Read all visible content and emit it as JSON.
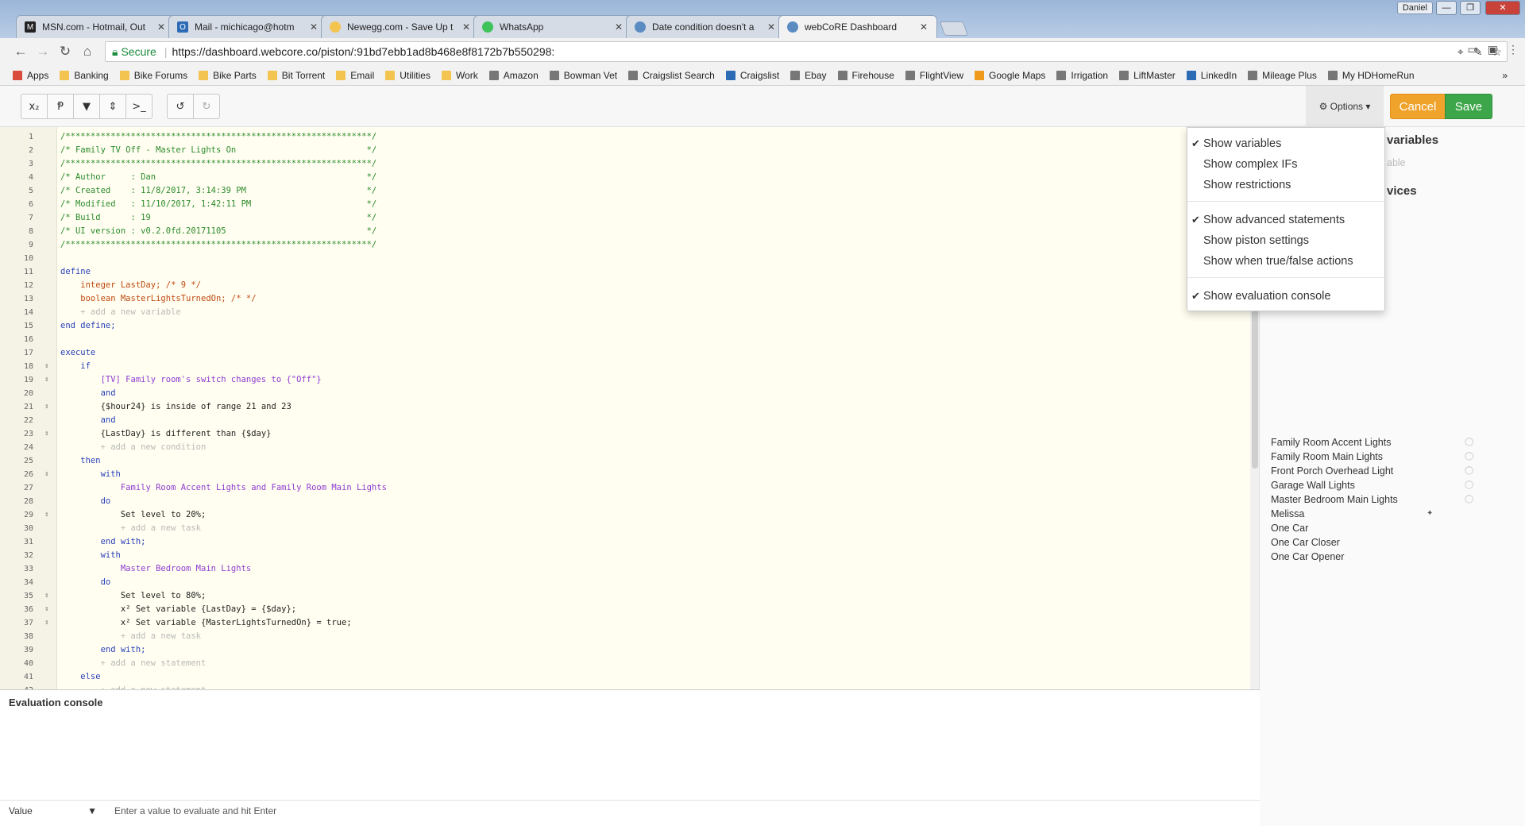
{
  "browser": {
    "tabs": [
      {
        "title": "MSN.com - Hotmail, Out",
        "icon_color": "#222"
      },
      {
        "title": "Mail - michicago@hotm",
        "icon_color": "#2d6bb5"
      },
      {
        "title": "Newegg.com - Save Up t",
        "icon_color": "#f3c44f"
      },
      {
        "title": "WhatsApp",
        "icon_color": "#3ec35b"
      },
      {
        "title": "Date condition doesn't a",
        "icon_color": "#5a8cc2"
      },
      {
        "title": "webCoRE Dashboard",
        "icon_color": "#5a8cc2"
      }
    ],
    "user": "Daniel",
    "window_title": "",
    "secure_label": "Secure",
    "url_host": "https://dashboard.webcore.co",
    "url_path": "/piston/:91bd7ebb1ad8b468e8f8172b7b550298:",
    "bookmarks": [
      {
        "label": "Apps",
        "icon": "apps-grid-icon"
      },
      {
        "label": "Banking",
        "icon": "folder-icon"
      },
      {
        "label": "Bike Forums",
        "icon": "folder-icon"
      },
      {
        "label": "Bike Parts",
        "icon": "folder-icon"
      },
      {
        "label": "Bit Torrent",
        "icon": "folder-icon"
      },
      {
        "label": "Email",
        "icon": "folder-icon"
      },
      {
        "label": "Utilities",
        "icon": "folder-icon"
      },
      {
        "label": "Work",
        "icon": "folder-icon"
      },
      {
        "label": "Amazon",
        "icon": "amazon-icon"
      },
      {
        "label": "Bowman Vet",
        "icon": "page-icon"
      },
      {
        "label": "Craigslist Search",
        "icon": "page-icon"
      },
      {
        "label": "Craigslist",
        "icon": "peace-icon"
      },
      {
        "label": "Ebay",
        "icon": "page-icon"
      },
      {
        "label": "Firehouse",
        "icon": "page-icon"
      },
      {
        "label": "FlightView",
        "icon": "page-icon"
      },
      {
        "label": "Google Maps",
        "icon": "map-icon"
      },
      {
        "label": "Irrigation",
        "icon": "page-icon"
      },
      {
        "label": "LiftMaster",
        "icon": "page-icon"
      },
      {
        "label": "LinkedIn",
        "icon": "linkedin-icon"
      },
      {
        "label": "Mileage Plus",
        "icon": "page-icon"
      },
      {
        "label": "My HDHomeRun",
        "icon": "page-icon"
      }
    ],
    "bookmarks_more": "»"
  },
  "toolbar": {
    "buttons": [
      "x₂",
      "Ᵽ",
      "▼",
      "⇕",
      ">_"
    ],
    "undo": "↺",
    "redo": "↻",
    "options_label": "⚙ Options ▾",
    "cancel_label": "Cancel",
    "save_label": "Save"
  },
  "options_menu": {
    "items": [
      {
        "label": "Show variables",
        "checked": true
      },
      {
        "label": "Show complex IFs",
        "checked": false
      },
      {
        "label": "Show restrictions",
        "checked": false
      },
      {
        "label": "Show advanced statements",
        "checked": true
      },
      {
        "label": "Show piston settings",
        "checked": false
      },
      {
        "label": "Show when true/false actions",
        "checked": false
      },
      {
        "label": "Show evaluation console",
        "checked": true
      }
    ]
  },
  "sidebar": {
    "variables_heading": "variables",
    "variables_hint": "able",
    "devices_heading": "vices",
    "devices": [
      "Family Room Accent Lights",
      "Family Room Main Lights",
      "Front Porch Overhead Light",
      "Garage Wall Lights",
      "Master Bedroom Main Lights",
      "Melissa",
      "One Car",
      "One Car Closer",
      "One Car Opener"
    ]
  },
  "code": {
    "lines": [
      "/*************************************************************/",
      "/* Family TV Off - Master Lights On                          */",
      "/*************************************************************/",
      "/* Author     : Dan                                          */",
      "/* Created    : 11/8/2017, 3:14:39 PM                        */",
      "/* Modified   : 11/10/2017, 1:42:11 PM                       */",
      "/* Build      : 19                                           */",
      "/* UI version : v0.2.0fd.20171105                            */",
      "/*************************************************************/",
      "",
      "define",
      "    integer LastDay; /* 9 */",
      "    boolean MasterLightsTurnedOn; /* */",
      "    + add a new variable",
      "end define;",
      "",
      "execute",
      "    if",
      "        [TV] Family room's switch changes to {\"Off\"}",
      "        and",
      "        {$hour24} is inside of range 21 and 23",
      "        and",
      "        {LastDay} is different than {$day}",
      "        + add a new condition",
      "    then",
      "        with",
      "            Family Room Accent Lights and Family Room Main Lights",
      "        do",
      "            Set level to 20%;",
      "            + add a new task",
      "        end with;",
      "        with",
      "            Master Bedroom Main Lights",
      "        do",
      "            Set level to 80%;",
      "            x² Set variable {LastDay} = {$day};",
      "            x² Set variable {MasterLightsTurnedOn} = true;",
      "            + add a new task",
      "        end with;",
      "        + add a new statement",
      "    else",
      "        + add a new statement"
    ]
  },
  "console": {
    "title": "Evaluation console",
    "select_value": "Value",
    "input_placeholder": "Enter a value to evaluate and hit Enter"
  }
}
